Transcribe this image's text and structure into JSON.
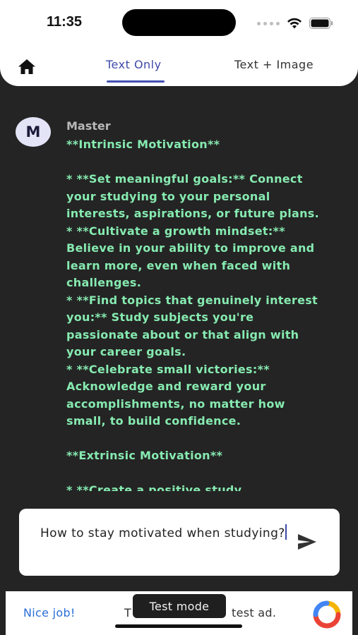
{
  "status_bar": {
    "time": "11:35"
  },
  "tabs": [
    {
      "label": "Text Only",
      "active": true
    },
    {
      "label": "Text + Image",
      "active": false
    }
  ],
  "message": {
    "avatar_letter": "M",
    "sender": "Master",
    "lines": [
      "**Intrinsic Motivation**",
      "",
      "* **Set meaningful goals:** Connect",
      "your studying to your personal",
      "interests, aspirations, or future plans.",
      "* **Cultivate a growth mindset:**",
      "Believe in your ability to improve and",
      "learn more, even when faced with",
      "challenges.",
      "* **Find topics that genuinely interest",
      "you:** Study subjects you're",
      "passionate about or that align with",
      "your career goals.",
      "* **Celebrate small victories:**",
      "Acknowledge and reward your",
      "accomplishments, no matter how",
      "small, to build confidence.",
      "",
      "**Extrinsic Motivation**",
      "",
      "* **Create a positive study"
    ]
  },
  "input": {
    "value": "How to stay motivated when studying?"
  },
  "ad": {
    "left_text": "Nice job!",
    "middle_text": "T",
    "right_text": "test ad."
  },
  "toast": {
    "text": "Test mode"
  },
  "colors": {
    "message_text": "#86eab0",
    "accent": "#4351b3",
    "background": "#242424"
  }
}
